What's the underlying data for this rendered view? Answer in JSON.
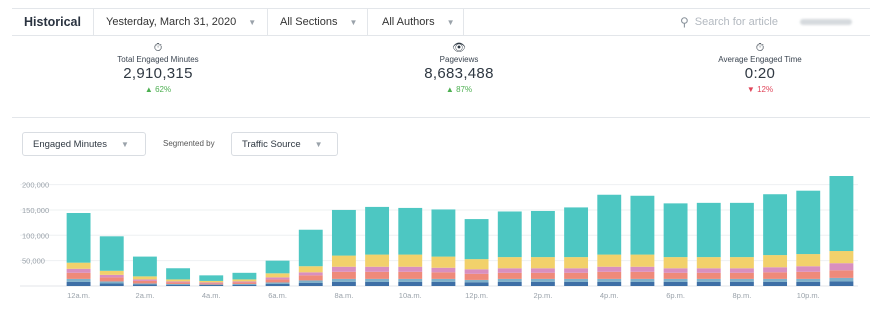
{
  "topbar": {
    "title": "Historical",
    "date": "Yesterday, March 31, 2020",
    "sections": "All Sections",
    "authors": "All Authors",
    "search_placeholder": "Search for article"
  },
  "stats": [
    {
      "icon": "stopwatch-icon",
      "glyph": "⏱",
      "label": "Total Engaged Minutes",
      "value": "2,910,315",
      "change": "▲ 62%",
      "trend": "up"
    },
    {
      "icon": "eye-icon",
      "glyph": "👁",
      "label": "Pageviews",
      "value": "8,683,488",
      "change": "▲ 87%",
      "trend": "up"
    },
    {
      "icon": "timer-icon",
      "glyph": "⏱",
      "label": "Average Engaged Time",
      "value": "0:20",
      "change": "▼ 12%",
      "trend": "down"
    }
  ],
  "controls": {
    "metric": "Engaged Minutes",
    "segmented_by_label": "Segmented by",
    "segment": "Traffic Source"
  },
  "colors": {
    "up": "#4caf50",
    "down": "#e0455a",
    "segments": [
      "#3e6fa6",
      "#7fb0c9",
      "#ef8a7a",
      "#d98fbf",
      "#f2d16b",
      "#4dc7c2"
    ]
  },
  "chart_data": {
    "type": "bar",
    "stacked": true,
    "categories": [
      "12a.m.",
      "1a.m.",
      "2a.m.",
      "3a.m.",
      "4a.m.",
      "5a.m.",
      "6a.m.",
      "7a.m.",
      "8a.m.",
      "9a.m.",
      "10a.m.",
      "11a.m.",
      "12p.m.",
      "1p.m.",
      "2p.m.",
      "3p.m.",
      "4p.m.",
      "5p.m.",
      "6p.m.",
      "7p.m.",
      "8p.m.",
      "9p.m.",
      "10p.m.",
      "11p.m."
    ],
    "tick_labels": [
      "12a.m.",
      "",
      "2a.m.",
      "",
      "4a.m.",
      "",
      "6a.m.",
      "",
      "8a.m.",
      "",
      "10a.m.",
      "",
      "12p.m.",
      "",
      "2p.m.",
      "",
      "4p.m.",
      "",
      "6p.m.",
      "",
      "8p.m.",
      "",
      "10p.m.",
      ""
    ],
    "y_ticks": [
      "50,000",
      "100,000",
      "150,000",
      "200,000"
    ],
    "y_tick_values": [
      50000,
      100000,
      150000,
      200000
    ],
    "ylim": [
      0,
      215000
    ],
    "series": [
      {
        "values": [
          8000,
          5000,
          3000,
          2000,
          2000,
          2000,
          4000,
          6000,
          8000,
          8000,
          8000,
          8000,
          7000,
          8000,
          8000,
          8000,
          8000,
          8000,
          8000,
          8000,
          8000,
          8000,
          8000,
          9000
        ]
      },
      {
        "values": [
          6000,
          4000,
          2000,
          2000,
          1000,
          2000,
          3000,
          5000,
          6000,
          6000,
          6000,
          6000,
          5000,
          6000,
          6000,
          6000,
          6000,
          6000,
          6000,
          6000,
          6000,
          6000,
          6000,
          7000
        ]
      },
      {
        "values": [
          12000,
          8000,
          5000,
          3000,
          2000,
          3000,
          6000,
          10000,
          14000,
          14000,
          14000,
          13000,
          12000,
          12000,
          12000,
          12000,
          14000,
          14000,
          12000,
          12000,
          12000,
          13000,
          14000,
          15000
        ]
      },
      {
        "values": [
          8000,
          5000,
          3000,
          2000,
          2000,
          2000,
          4000,
          6000,
          10000,
          10000,
          10000,
          9000,
          9000,
          9000,
          9000,
          9000,
          10000,
          10000,
          9000,
          9000,
          9000,
          10000,
          11000,
          14000
        ]
      },
      {
        "values": [
          12000,
          8000,
          6000,
          4000,
          3000,
          4000,
          8000,
          12000,
          22000,
          24000,
          24000,
          22000,
          20000,
          22000,
          22000,
          22000,
          24000,
          24000,
          22000,
          22000,
          22000,
          24000,
          24000,
          24000
        ]
      },
      {
        "values": [
          98000,
          68000,
          39000,
          22000,
          11000,
          13000,
          25000,
          72000,
          90000,
          94000,
          92000,
          93000,
          79000,
          90000,
          91000,
          98000,
          118000,
          116000,
          106000,
          107000,
          107000,
          120000,
          125000,
          151000
        ]
      }
    ]
  }
}
